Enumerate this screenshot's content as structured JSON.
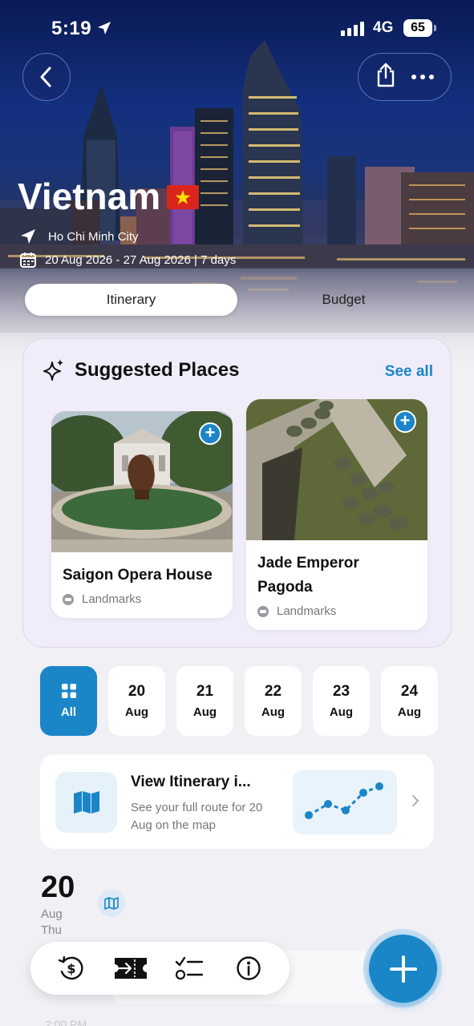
{
  "status_bar": {
    "time": "5:19",
    "network": "4G",
    "battery": "65"
  },
  "destination": {
    "country": "Vietnam",
    "flag": "vietnam-flag",
    "city": "Ho Chi Minh City",
    "dates": "20 Aug 2026 - 27 Aug 2026 | 7 days"
  },
  "tabs": [
    {
      "label": "Itinerary",
      "active": true
    },
    {
      "label": "Budget",
      "active": false
    }
  ],
  "suggested": {
    "title": "Suggested Places",
    "see_all": "See all",
    "places": [
      {
        "name": "Saigon Opera House",
        "category": "Landmarks"
      },
      {
        "name": "Jade Emperor Pagoda",
        "category": "Landmarks"
      }
    ]
  },
  "date_chips": {
    "all_label": "All",
    "days": [
      {
        "day": "20",
        "month": "Aug"
      },
      {
        "day": "21",
        "month": "Aug"
      },
      {
        "day": "22",
        "month": "Aug"
      },
      {
        "day": "23",
        "month": "Aug"
      },
      {
        "day": "24",
        "month": "Aug"
      }
    ]
  },
  "map_card": {
    "title": "View Itinerary i...",
    "description": "See your full route for 20 Aug on the map"
  },
  "day_header": {
    "day": "20",
    "month": "Aug",
    "weekday": "Thu"
  },
  "faded": {
    "time": "2:00 PM"
  },
  "colors": {
    "accent": "#1a86c8",
    "suggest_bg": "#f1ecf9",
    "page_bg": "#f0f0f5"
  },
  "toolbar": {
    "icons": [
      "budget-refresh-icon",
      "ticket-icon",
      "checklist-icon",
      "info-icon"
    ]
  }
}
